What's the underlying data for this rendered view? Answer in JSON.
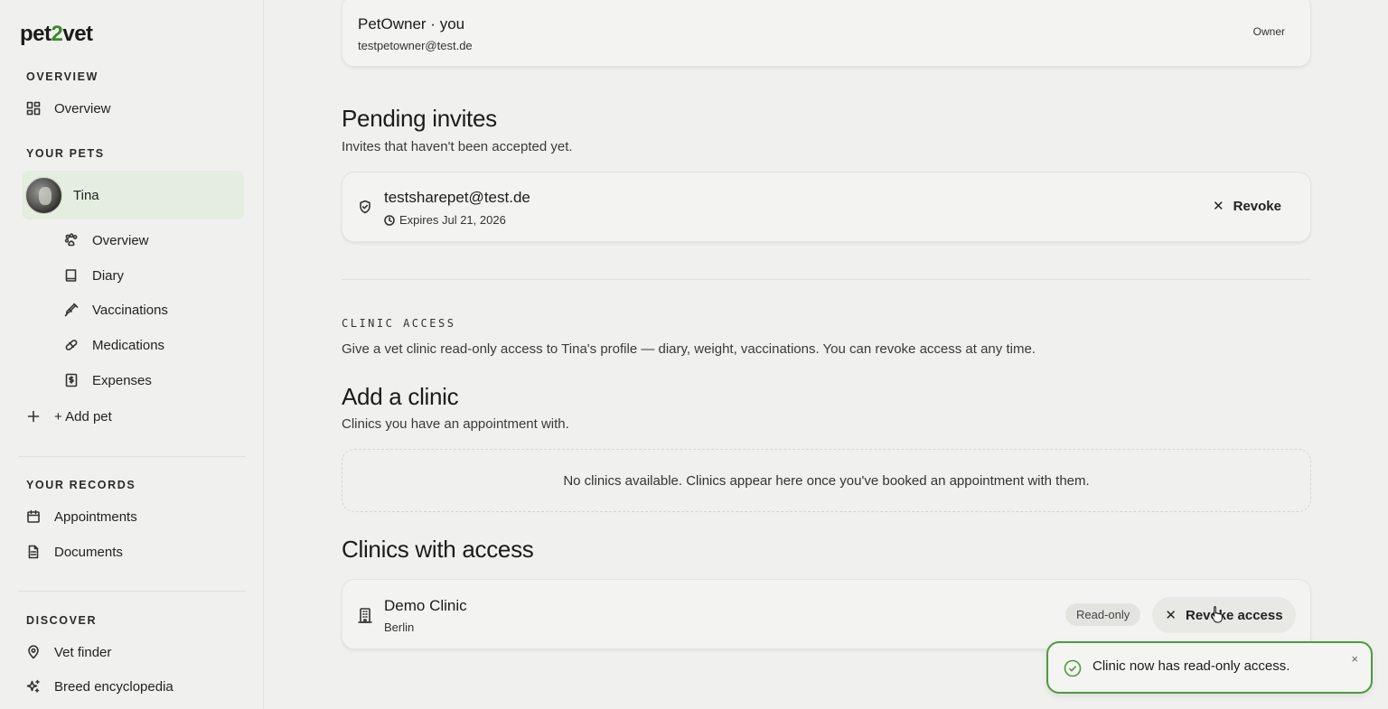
{
  "brand": {
    "logo_pre": "pet",
    "logo_two": "2",
    "logo_post": "vet"
  },
  "sidebar": {
    "overview_label": "OVERVIEW",
    "overview_item": "Overview",
    "pets_label": "YOUR PETS",
    "pet": {
      "name": "Tina"
    },
    "pet_items": [
      "Overview",
      "Diary",
      "Vaccinations",
      "Medications",
      "Expenses"
    ],
    "add_pet": "+ Add pet",
    "records_label": "YOUR RECORDS",
    "records_items": [
      "Appointments",
      "Documents"
    ],
    "discover_label": "DISCOVER",
    "discover_items": [
      "Vet finder",
      "Breed encyclopedia"
    ]
  },
  "owner": {
    "name": "PetOwner · you",
    "email": "testpetowner@test.de",
    "role": "Owner"
  },
  "pending": {
    "title": "Pending invites",
    "subtitle": "Invites that haven't been accepted yet.",
    "invite": {
      "email": "testsharepet@test.de",
      "expires": "Expires Jul 21, 2026",
      "action": "Revoke"
    }
  },
  "clinic_access": {
    "label": "CLINIC ACCESS",
    "description": "Give a vet clinic read-only access to Tina's profile — diary, weight, vaccinations. You can revoke access at any time.",
    "add_title": "Add a clinic",
    "add_subtitle": "Clinics you have an appointment with.",
    "empty_message": "No clinics available. Clinics appear here once you've booked an appointment with them.",
    "with_access_title": "Clinics with access",
    "clinic": {
      "name": "Demo Clinic",
      "city": "Berlin",
      "badge": "Read-only",
      "action": "Revoke access"
    }
  },
  "toast": {
    "message": "Clinic now has read-only access.",
    "close": "×",
    "accent": "#4d9a3e"
  }
}
